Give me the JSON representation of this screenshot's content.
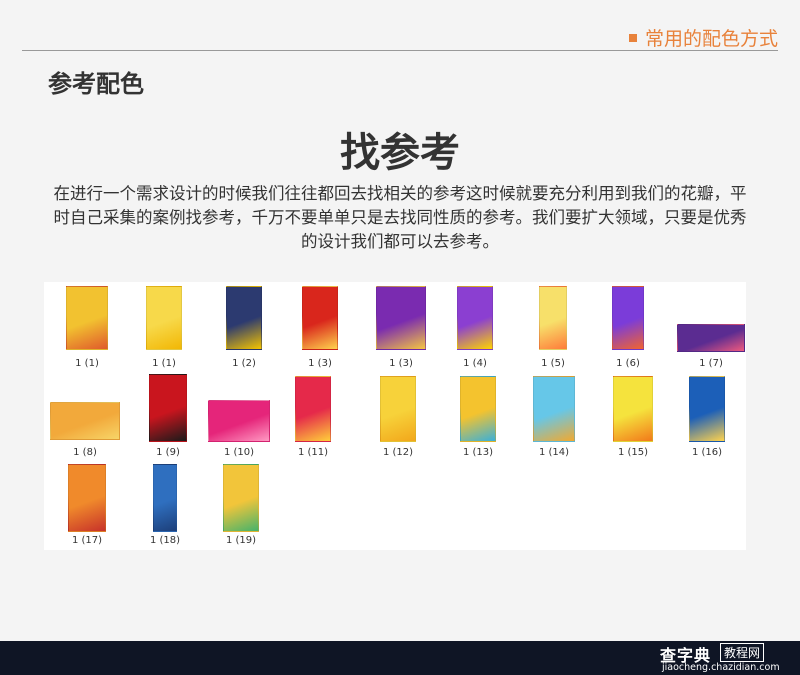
{
  "header": {
    "section_tag": "常用的配色方式"
  },
  "section_title": "参考配色",
  "main_title": "找参考",
  "description": "在进行一个需求设计的时候我们往往都回去找相关的参考这时候就要充分利用到我们的花瓣，平时自己采集的案例找参考，千万不要单单只是去找同性质的参考。我们要扩大领域，只要是优秀的设计我们都可以去参考。",
  "thumbnails": [
    {
      "caption": "1 (1)",
      "colors": [
        "#f2c230",
        "#e05a2b"
      ]
    },
    {
      "caption": "1 (1)",
      "colors": [
        "#f7d94a",
        "#f2b705"
      ]
    },
    {
      "caption": "1 (2)",
      "colors": [
        "#2c3a70",
        "#f4c400"
      ]
    },
    {
      "caption": "1 (3)",
      "colors": [
        "#d9261c",
        "#ffd34d"
      ]
    },
    {
      "caption": "1 (3)",
      "colors": [
        "#7a2bb0",
        "#f5c542"
      ]
    },
    {
      "caption": "1 (4)",
      "colors": [
        "#8b3fd1",
        "#ffd400"
      ]
    },
    {
      "caption": "1 (5)",
      "colors": [
        "#f7e06a",
        "#ff7c3a"
      ]
    },
    {
      "caption": "1 (6)",
      "colors": [
        "#7b3cd9",
        "#f1642f"
      ]
    },
    {
      "caption": "1 (7)",
      "colors": [
        "#5b2c91",
        "#f05a7e"
      ]
    },
    {
      "caption": "1 (8)",
      "colors": [
        "#f2a93b",
        "#f7d568"
      ]
    },
    {
      "caption": "1 (9)",
      "colors": [
        "#c9151e",
        "#1a1a1a"
      ]
    },
    {
      "caption": "1 (10)",
      "colors": [
        "#e5257a",
        "#ff9ac3"
      ]
    },
    {
      "caption": "1 (11)",
      "colors": [
        "#e5294a",
        "#ffcf3a"
      ]
    },
    {
      "caption": "1 (12)",
      "colors": [
        "#f7d23a",
        "#f2a71b"
      ]
    },
    {
      "caption": "1 (13)",
      "colors": [
        "#f4c32e",
        "#3ab0d9"
      ]
    },
    {
      "caption": "1 (14)",
      "colors": [
        "#66c7e8",
        "#f2a92f"
      ]
    },
    {
      "caption": "1 (15)",
      "colors": [
        "#f5e33d",
        "#f27a1a"
      ]
    },
    {
      "caption": "1 (16)",
      "colors": [
        "#1c5fb8",
        "#ffd34d"
      ]
    },
    {
      "caption": "1 (17)",
      "colors": [
        "#f08a2b",
        "#c7322a"
      ]
    },
    {
      "caption": "1 (18)",
      "colors": [
        "#2f6fbf",
        "#1d3f7a"
      ]
    },
    {
      "caption": "1 (19)",
      "colors": [
        "#f2c53a",
        "#45b36b"
      ]
    }
  ],
  "watermark": {
    "main": "查字典",
    "box": "教程网",
    "url": "jiaocheng.chazidian.com"
  }
}
